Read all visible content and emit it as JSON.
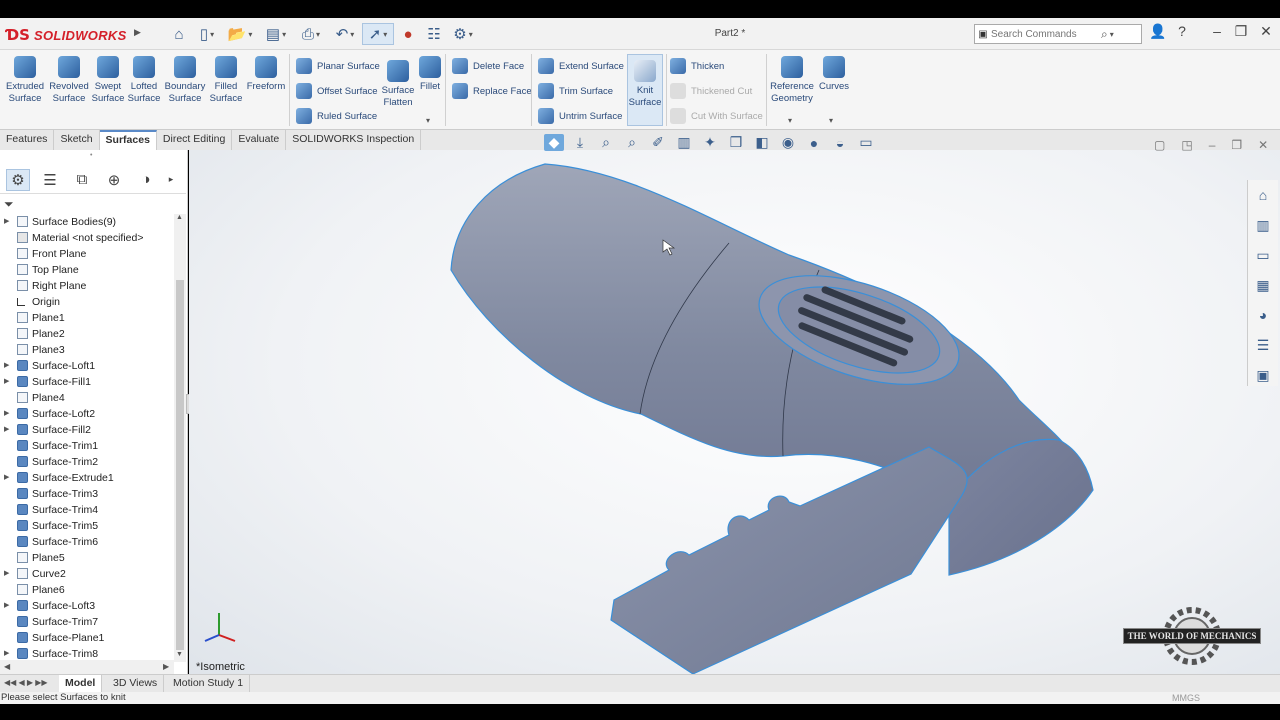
{
  "app": {
    "logo_mark": "ƊS",
    "logo_text": "SOLIDWORKS",
    "doc_title": "Part2 *"
  },
  "search": {
    "placeholder": "Search Commands"
  },
  "ribbon": {
    "large_left": [
      {
        "label": "Extruded Surface"
      },
      {
        "label": "Revolved Surface"
      },
      {
        "label": "Swept Surface"
      },
      {
        "label": "Lofted Surface"
      },
      {
        "label": "Boundary Surface"
      },
      {
        "label": "Filled Surface"
      },
      {
        "label": "Freeform"
      }
    ],
    "col1": [
      "Planar Surface",
      "Offset Surface",
      "Ruled Surface"
    ],
    "surface_flatten": "Surface Flatten",
    "fillet": "Fillet",
    "col2": [
      "Delete Face",
      "Replace Face"
    ],
    "col3": [
      "Extend Surface",
      "Trim Surface",
      "Untrim Surface"
    ],
    "knit": "Knit Surface",
    "col4": [
      "Thicken",
      "Thickened Cut",
      "Cut With Surface"
    ],
    "ref_geom": "Reference Geometry",
    "curves": "Curves"
  },
  "tabs": [
    "Features",
    "Sketch",
    "Surfaces",
    "Direct Editing",
    "Evaluate",
    "SOLIDWORKS Inspection"
  ],
  "tree": [
    {
      "label": "Surface Bodies(9)",
      "icon": "folder",
      "exp": true
    },
    {
      "label": "Material <not specified>",
      "icon": "mat",
      "exp": false
    },
    {
      "label": "Front Plane",
      "icon": "plane",
      "exp": false
    },
    {
      "label": "Top Plane",
      "icon": "plane",
      "exp": false
    },
    {
      "label": "Right Plane",
      "icon": "plane",
      "exp": false
    },
    {
      "label": "Origin",
      "icon": "orig",
      "exp": false
    },
    {
      "label": "Plane1",
      "icon": "plane",
      "exp": false
    },
    {
      "label": "Plane2",
      "icon": "plane",
      "exp": false
    },
    {
      "label": "Plane3",
      "icon": "plane",
      "exp": false
    },
    {
      "label": "Surface-Loft1",
      "icon": "surf",
      "exp": true
    },
    {
      "label": "Surface-Fill1",
      "icon": "surf",
      "exp": true
    },
    {
      "label": "Plane4",
      "icon": "plane",
      "exp": false
    },
    {
      "label": "Surface-Loft2",
      "icon": "surf",
      "exp": true
    },
    {
      "label": "Surface-Fill2",
      "icon": "surf",
      "exp": true
    },
    {
      "label": "Surface-Trim1",
      "icon": "surf",
      "exp": false
    },
    {
      "label": "Surface-Trim2",
      "icon": "surf",
      "exp": false
    },
    {
      "label": "Surface-Extrude1",
      "icon": "surf",
      "exp": true
    },
    {
      "label": "Surface-Trim3",
      "icon": "surf",
      "exp": false
    },
    {
      "label": "Surface-Trim4",
      "icon": "surf",
      "exp": false
    },
    {
      "label": "Surface-Trim5",
      "icon": "surf",
      "exp": false
    },
    {
      "label": "Surface-Trim6",
      "icon": "surf",
      "exp": false
    },
    {
      "label": "Plane5",
      "icon": "plane",
      "exp": false
    },
    {
      "label": "Curve2",
      "icon": "plane",
      "exp": true
    },
    {
      "label": "Plane6",
      "icon": "plane",
      "exp": false
    },
    {
      "label": "Surface-Loft3",
      "icon": "surf",
      "exp": true
    },
    {
      "label": "Surface-Trim7",
      "icon": "surf",
      "exp": false
    },
    {
      "label": "Surface-Plane1",
      "icon": "surf",
      "exp": false
    },
    {
      "label": "Surface-Trim8",
      "icon": "surf",
      "exp": true
    }
  ],
  "viewport": {
    "view_label": "*Isometric",
    "watermark": "THE WORLD OF MECHANICS"
  },
  "bottom_tabs": [
    "Model",
    "3D Views",
    "Motion Study 1"
  ],
  "status": {
    "message": "Please select Surfaces to knit",
    "units": "MMGS"
  }
}
